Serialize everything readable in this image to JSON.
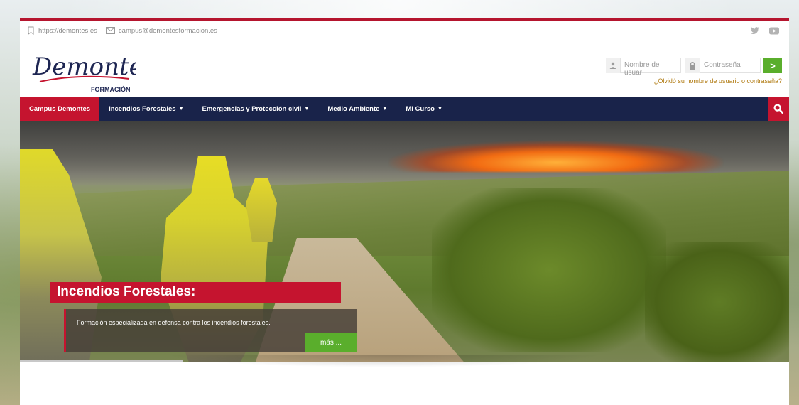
{
  "topbar": {
    "url": "https://demontes.es",
    "email": "campus@demontesformacion.es"
  },
  "logo": {
    "text": "Demontes",
    "subtitle": "FORMACIÓN"
  },
  "login": {
    "username_placeholder": "Nombre de usuar",
    "password_placeholder": "Contraseña",
    "submit_label": ">",
    "forgot_link": "¿Olvidó su nombre de usuario o contraseña?"
  },
  "nav": {
    "items": [
      {
        "label": "Campus Demontes",
        "has_dropdown": false
      },
      {
        "label": "Incendios Forestales",
        "has_dropdown": true
      },
      {
        "label": "Emergencias y Protección civil",
        "has_dropdown": true
      },
      {
        "label": "Medio Ambiente",
        "has_dropdown": true
      },
      {
        "label": "Mi Curso",
        "has_dropdown": true
      }
    ],
    "caret": "▼"
  },
  "hero": {
    "title": "Incendios Forestales:",
    "description": "Formación especializada en defensa contra los incendios forestales.",
    "more_label": "más ..."
  },
  "colors": {
    "accent_red": "#c5142f",
    "nav_blue": "#19234a",
    "button_green": "#5aae2c",
    "link_gold": "#b07a10"
  }
}
